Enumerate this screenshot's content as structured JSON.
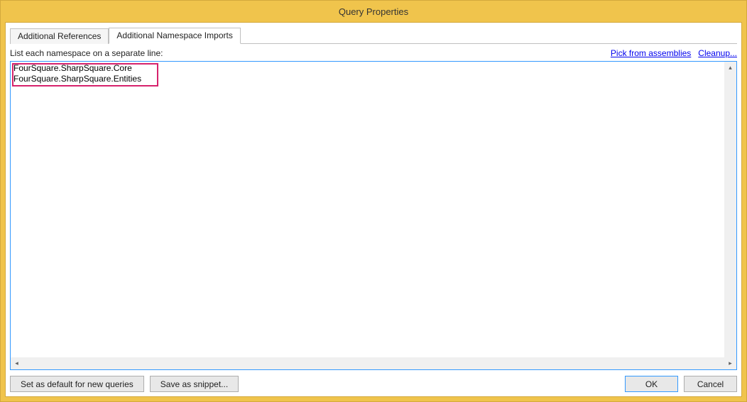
{
  "window": {
    "title": "Query Properties"
  },
  "tabs": {
    "references": "Additional References",
    "namespace_imports": "Additional Namespace Imports"
  },
  "label": "List each namespace on a separate line:",
  "links": {
    "pick": "Pick from assemblies",
    "cleanup": "Cleanup..."
  },
  "textarea_content": "FourSquare.SharpSquare.Core\nFourSquare.SharpSquare.Entities",
  "buttons": {
    "set_default": "Set as default for new queries",
    "save_snippet": "Save as snippet...",
    "ok": "OK",
    "cancel": "Cancel"
  }
}
